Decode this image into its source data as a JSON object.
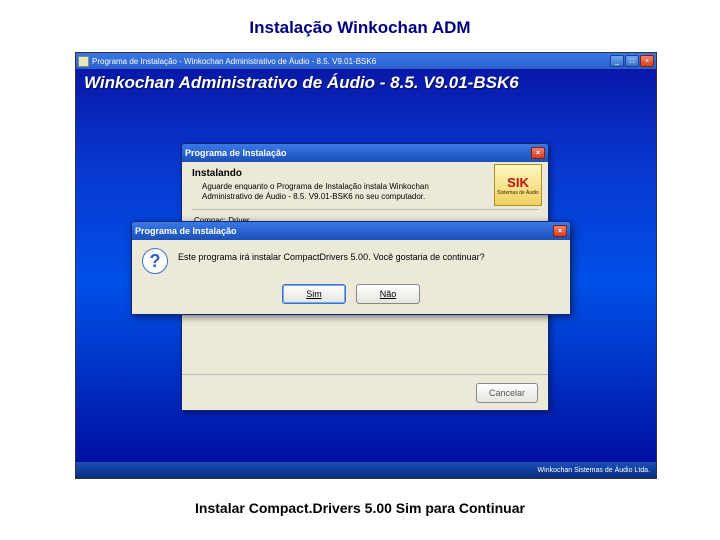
{
  "slide": {
    "title": "Instalação Winkochan ADM",
    "caption": "Instalar Compact.Drivers 5.00 Sim para Continuar"
  },
  "outer_window": {
    "title": "Programa de Instalação - Winkochan Administrativo de Áudio - 8.5. V9.01-BSK6"
  },
  "product_banner": "Winkochan Administrativo de Áudio - 8.5. V9.01-BSK6",
  "installer": {
    "title": "Programa de Instalação",
    "heading": "Instalando",
    "subtext": "Aguarde enquanto o Programa de Instalação instala Winkochan Administrativo de Áudio - 8.5. V9.01-BSK6 no seu computador.",
    "status": "Compac: Driver",
    "cancel": "Cancelar",
    "logo_text": "SIK",
    "logo_sub": "Sistemas de Áudio"
  },
  "confirm": {
    "title": "Programa de Instalação",
    "message": "Este programa irá instalar CompactDrivers 5.00. Você gostaria de continuar?",
    "yes": "Sim",
    "no": "Não"
  },
  "statusbar": {
    "text": "Winkochan Sistemas de Áudio Ltda."
  },
  "icons": {
    "minimize": "_",
    "maximize": "□",
    "close": "×",
    "question": "?"
  }
}
